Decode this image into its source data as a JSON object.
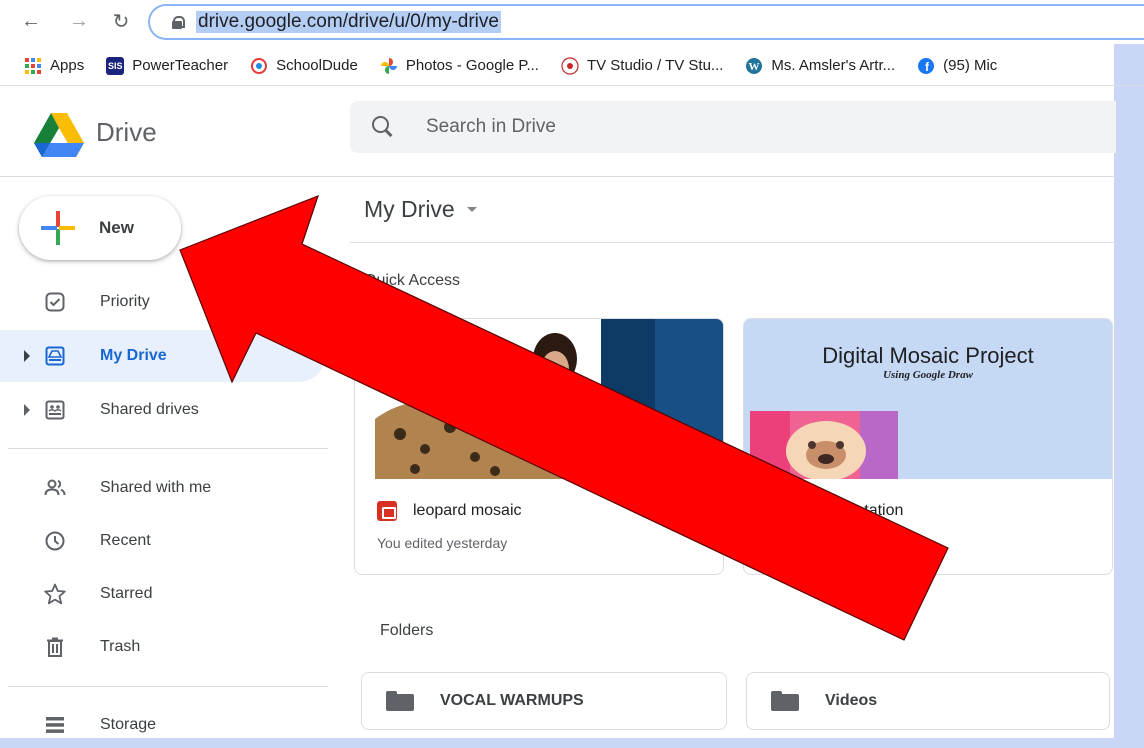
{
  "browser": {
    "url": "drive.google.com/drive/u/0/my-drive"
  },
  "bookmarks": [
    {
      "label": "Apps",
      "icon": "apps-grid-icon"
    },
    {
      "label": "PowerTeacher",
      "icon": "sis-icon",
      "icon_text": "SIS"
    },
    {
      "label": "SchoolDude",
      "icon": "schooldude-icon"
    },
    {
      "label": "Photos - Google P...",
      "icon": "google-photos-icon"
    },
    {
      "label": "TV Studio / TV Stu...",
      "icon": "tv-studio-icon"
    },
    {
      "label": "Ms. Amsler's Artr...",
      "icon": "wordpress-icon"
    },
    {
      "label": "(95) Mic",
      "icon": "facebook-icon"
    }
  ],
  "header": {
    "app_name": "Drive",
    "search_placeholder": "Search in Drive"
  },
  "sidebar": {
    "new_label": "New",
    "items": [
      {
        "label": "Priority",
        "icon": "priority-check-icon"
      },
      {
        "label": "My Drive",
        "icon": "my-drive-icon"
      },
      {
        "label": "Shared drives",
        "icon": "shared-drives-icon"
      },
      {
        "label": "Shared with me",
        "icon": "people-icon"
      },
      {
        "label": "Recent",
        "icon": "clock-icon"
      },
      {
        "label": "Starred",
        "icon": "star-icon"
      },
      {
        "label": "Trash",
        "icon": "trash-icon"
      },
      {
        "label": "Storage",
        "icon": "storage-icon"
      }
    ]
  },
  "main": {
    "title": "My Drive",
    "quick_access_label": "Quick Access",
    "cards": [
      {
        "name": "leopard mosaic",
        "subtitle": "You edited yesterday"
      },
      {
        "name": "d presentation",
        "thumb_title": "Digital Mosaic Project",
        "thumb_subtitle": "Using Google Draw"
      }
    ],
    "folders_label": "Folders",
    "folders": [
      {
        "name": "VOCAL WARMUPS"
      },
      {
        "name": "Videos"
      }
    ]
  },
  "colors": {
    "accent_blue": "#1967d2",
    "active_bg": "#e8f0fe",
    "annotation_arrow": "#ff0000",
    "page_border": "#c9d6f5"
  }
}
